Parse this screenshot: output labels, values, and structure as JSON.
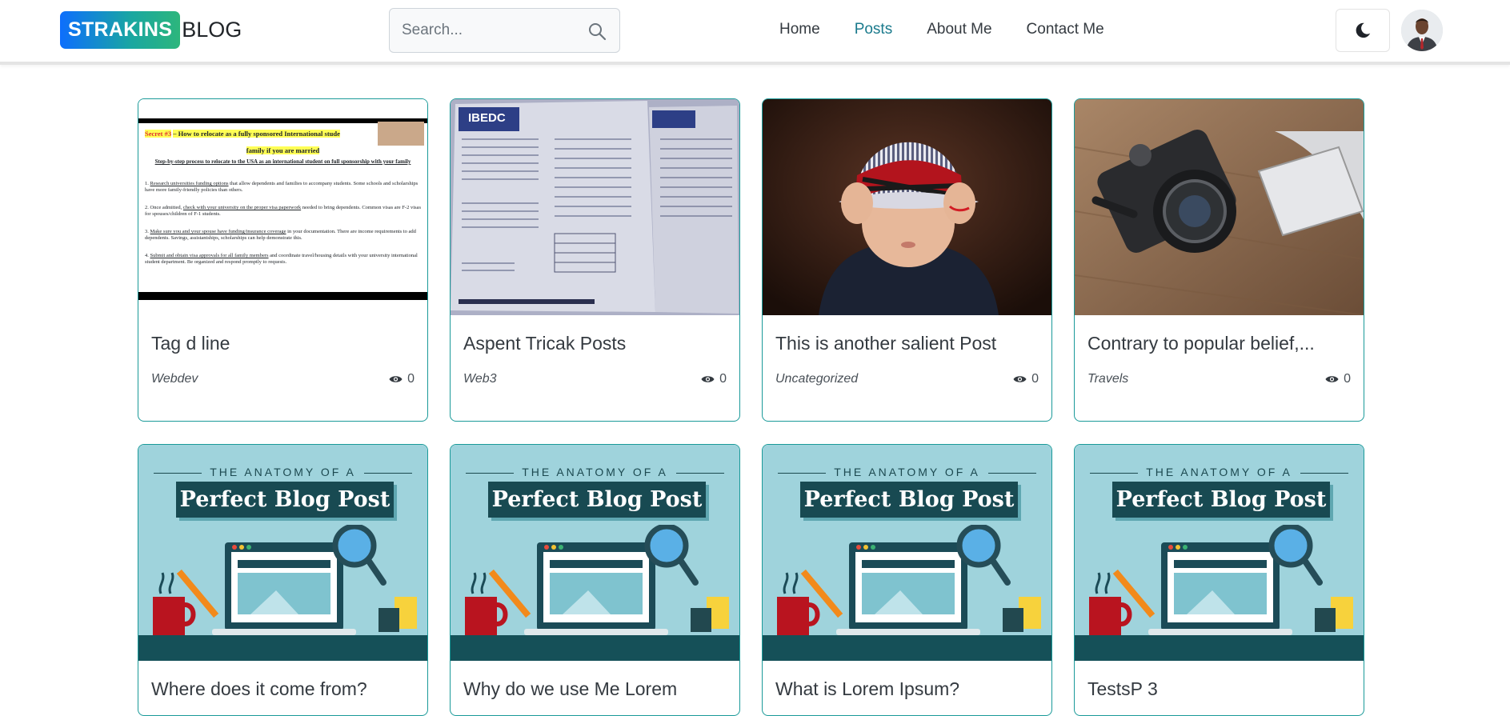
{
  "brand": {
    "badge": "STRAKINS",
    "suffix": "BLOG"
  },
  "search": {
    "placeholder": "Search..."
  },
  "nav": {
    "items": [
      "Home",
      "Posts",
      "About Me",
      "Contact Me"
    ],
    "active": "Posts"
  },
  "colors": {
    "accent": "#1a7a8c",
    "card_border": "#1a9a99"
  },
  "posts": [
    {
      "title": "Tag d line",
      "category": "Webdev",
      "views": "0",
      "thumb_doc": {
        "secret_label": "Secret #3",
        "heading_rest": "– How to relocate as a fully sponsored International stude",
        "heading_line2": "family if you are married",
        "subheading": "Step-by-step process to relocate to the USA as an international student on full sponsorship with your family",
        "item1_u": "Research universities funding options",
        "item1_rest": "that allow dependents and families to accompany students. Some schools and scholarships have more family-friendly policies than others.",
        "item2_u": "check with your university on the proper visa paperwork",
        "item2_pre": "2. Once admitted,",
        "item2_rest": "needed to bring dependents. Common visas are F-2 visas for spouses/children of F-1 students.",
        "item3_u": "Make sure you and your spouse have funding/insurance coverage",
        "item3_rest": "in your documentation. There are income requirements to add dependents. Savings, assistantships, scholarships can help demonstrate this.",
        "item4_u": "Submit and obtain visa approvals for all family members",
        "item4_rest": "and coordinate travel/housing details with your university international student department. Be organized and respond promptly to requests."
      }
    },
    {
      "title": "Aspent Tricak Posts",
      "category": "Web3",
      "views": "0",
      "thumb_label": "IBEDC"
    },
    {
      "title": "This is another salient Post",
      "category": "Uncategorized",
      "views": "0"
    },
    {
      "title": "Contrary to popular belief,...",
      "category": "Travels",
      "views": "0"
    },
    {
      "title": "Where does it come from?",
      "category": "",
      "views": ""
    },
    {
      "title": "Why do we use Me Lorem",
      "category": "",
      "views": ""
    },
    {
      "title": "What is Lorem Ipsum?",
      "category": "",
      "views": ""
    },
    {
      "title": "TestsP 3",
      "category": "",
      "views": ""
    }
  ],
  "anatomy": {
    "top": "THE ANATOMY OF A",
    "banner": "Perfect Blog Post"
  }
}
